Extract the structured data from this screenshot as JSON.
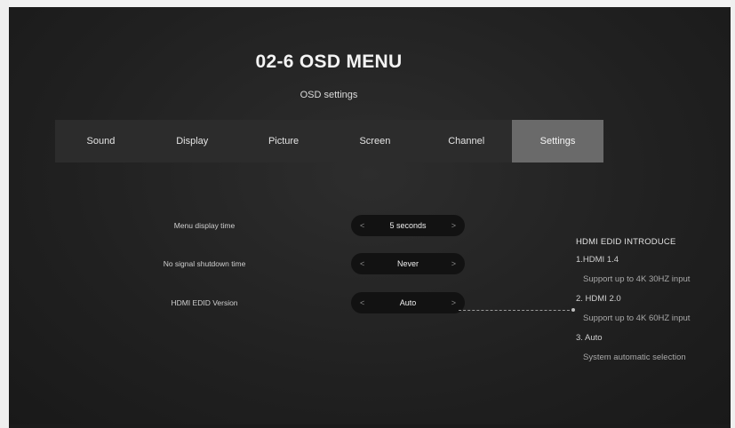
{
  "page": {
    "title": "02-6 OSD MENU",
    "subtitle": "OSD settings"
  },
  "tabs": [
    {
      "label": "Sound",
      "active": false
    },
    {
      "label": "Display",
      "active": false
    },
    {
      "label": "Picture",
      "active": false
    },
    {
      "label": "Screen",
      "active": false
    },
    {
      "label": "Channel",
      "active": false
    },
    {
      "label": "Settings",
      "active": true
    }
  ],
  "settings": [
    {
      "label": "Menu display time",
      "value": "5 seconds",
      "left_arrow": "<",
      "right_arrow": ">"
    },
    {
      "label": "No signal shutdown time",
      "value": "Never",
      "left_arrow": "<",
      "right_arrow": ">"
    },
    {
      "label": "HDMI EDID Version",
      "value": "Auto",
      "left_arrow": "<",
      "right_arrow": ">"
    }
  ],
  "info": {
    "heading": "HDMI EDID INTRODUCE",
    "items": [
      {
        "title": "1.HDMI 1.4",
        "detail": "Support up to 4K 30HZ input"
      },
      {
        "title": "2. HDMI 2.0",
        "detail": "Support up to 4K 60HZ input"
      },
      {
        "title": "3. Auto",
        "detail": "System automatic selection"
      }
    ]
  },
  "colors": {
    "background": "#222222",
    "tabbar": "#2c2c2c",
    "active_tab": "#6a6a6a",
    "pill": "#121212",
    "text": "#e9e9e9"
  }
}
